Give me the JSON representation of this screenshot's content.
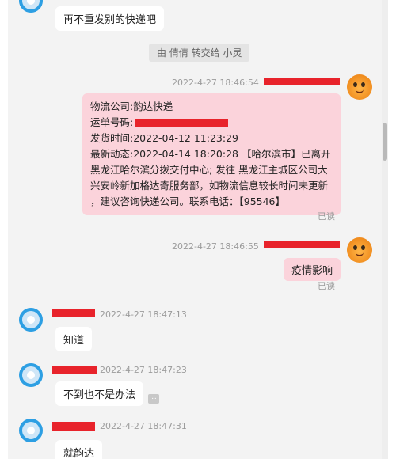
{
  "messages": {
    "m1_text": "再不重发别的快递吧",
    "system_note": "由 倩倩 转交给 小灵",
    "m2_time": "2022-4-27 18:46:54",
    "m2_lines": {
      "l1": "物流公司:韵达快递",
      "l2": "运单号码:",
      "l3": "发货时间:2022-04-12 11:23:29",
      "l4": "最新动态:2022-04-14 18:20:28 【哈尔滨市】已离开",
      "l5": "黑龙江哈尔滨分拨交付中心; 发往 黑龙江主城区公司大",
      "l6": "兴安岭新加格达奇服务部，如物流信息较长时间未更新",
      "l7": "，建议咨询快递公司。联系电话：【95546】"
    },
    "m2_read": "已读",
    "m3_time": "2022-4-27 18:46:55",
    "m3_text": "疫情影响",
    "m3_read": "已读",
    "m4_time": "2022-4-27 18:47:13",
    "m4_text": "知道",
    "m5_time": "2022-4-27 18:47:23",
    "m5_text": "不到也不是办法",
    "m5_more": "...",
    "m6_time": "2022-4-27 18:47:31",
    "m6_text": "就韵达"
  },
  "colors": {
    "redaction": "#e8232b",
    "agent_bubble": "#fbd3db",
    "user_bubble": "#ffffff",
    "user_avatar_ring": "#2d9fe3",
    "agent_avatar": "#f08c1e"
  }
}
